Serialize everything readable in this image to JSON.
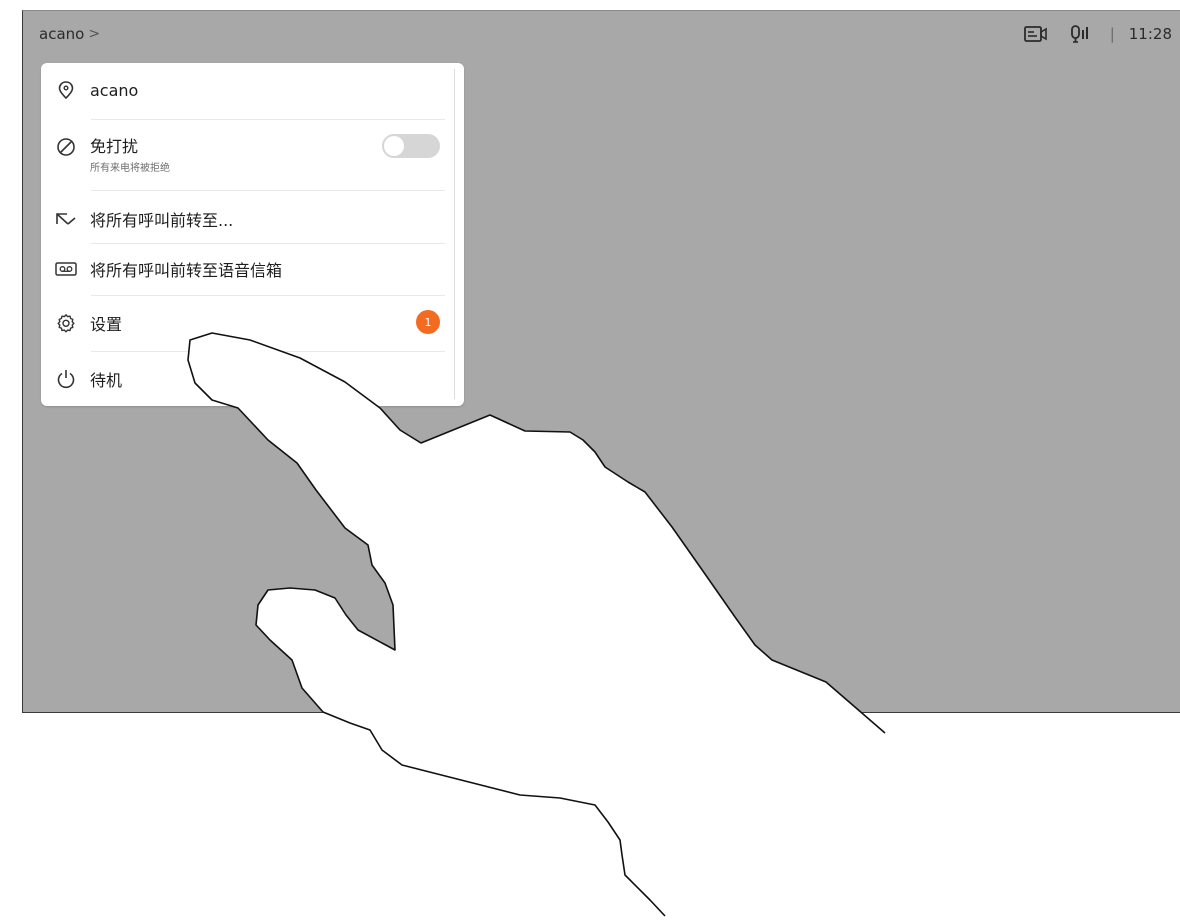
{
  "breadcrumb": {
    "label": "acano",
    "chevron": ">"
  },
  "status_bar": {
    "time": "11:28",
    "separator": "|",
    "icons": [
      "self-view-icon",
      "mic-level-icon"
    ]
  },
  "menu": {
    "items": [
      {
        "icon": "location-pin-icon",
        "label": "acano"
      },
      {
        "icon": "do-not-disturb-icon",
        "label": "免打扰",
        "sublabel": "所有来电将被拒绝",
        "toggle": false
      },
      {
        "icon": "forward-arrow-icon",
        "label": "将所有呼叫前转至..."
      },
      {
        "icon": "voicemail-icon",
        "label": "将所有呼叫前转至语音信箱"
      },
      {
        "icon": "gear-icon",
        "label": "设置",
        "badge": "1"
      },
      {
        "icon": "power-icon",
        "label": "待机"
      }
    ]
  },
  "colors": {
    "screen_bg": "#a8a8a8",
    "panel_bg": "#ffffff",
    "badge": "#f26b21",
    "toggle_off": "#d6d6d6"
  }
}
